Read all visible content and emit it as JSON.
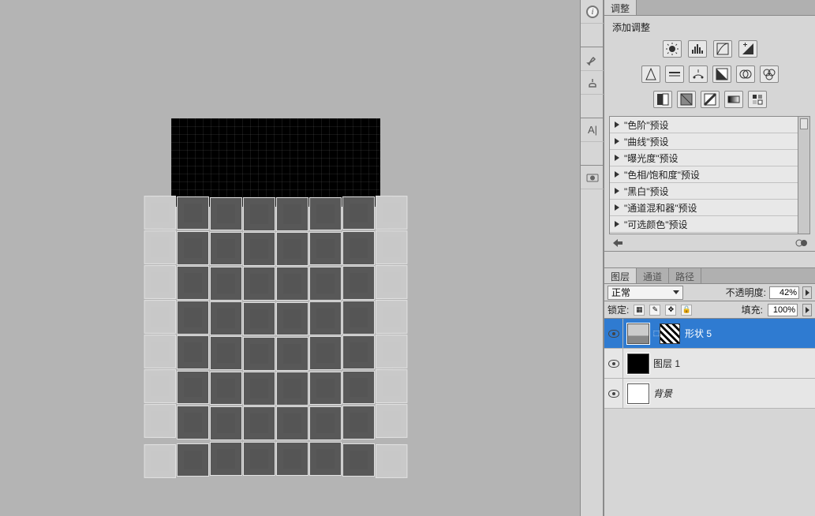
{
  "panels": {
    "adjust_tab": "调整",
    "adjust_title": "添加调整",
    "presets": [
      "\"色阶\"预设",
      "\"曲线\"预设",
      "\"曝光度\"预设",
      "\"色相/饱和度\"预设",
      "\"黑白\"预设",
      "\"通道混和器\"预设",
      "\"可选颜色\"预设"
    ]
  },
  "layers_panel": {
    "tabs": {
      "layers": "图层",
      "channels": "通道",
      "paths": "路径"
    },
    "blend_label_value": "正常",
    "opacity_label": "不透明度:",
    "opacity_value": "42%",
    "lock_label": "锁定:",
    "fill_label": "填充:",
    "fill_value": "100%",
    "layers": [
      {
        "name": "形状 5"
      },
      {
        "name": "图层 1"
      },
      {
        "name": "背景"
      }
    ]
  }
}
